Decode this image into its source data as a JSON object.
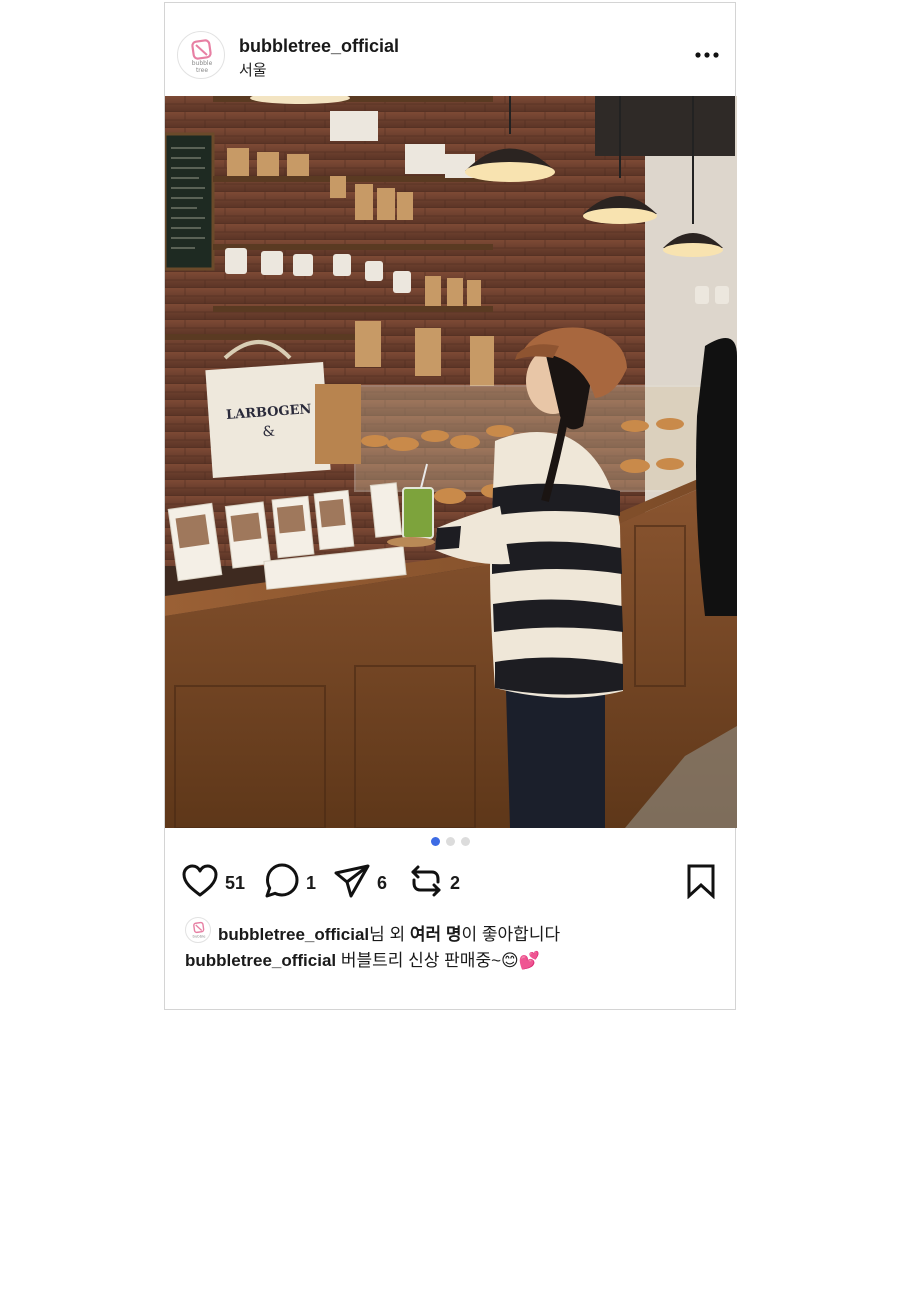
{
  "post": {
    "username": "bubbletree_official",
    "location": "서울",
    "avatar_text": [
      "bubble",
      "tree"
    ],
    "photo_alt": "girl in striped sweater at café counter",
    "carousel": {
      "total": 3,
      "active_index": 0
    }
  },
  "actions": {
    "likes": "51",
    "comments": "1",
    "shares": "6",
    "reposts": "2"
  },
  "liked_by": {
    "username": "bubbletree_official",
    "suffix_1": "님 외 ",
    "others": "여러 명",
    "suffix_2": "이 좋아합니다"
  },
  "caption": {
    "username": "bubbletree_official",
    "text": "버블트리 신상 판매중~",
    "emoji_1": "😊",
    "emoji_2": "💕"
  },
  "colors": {
    "accent_dot": "#3d6be4",
    "logo_pink": "#e77fa3"
  }
}
